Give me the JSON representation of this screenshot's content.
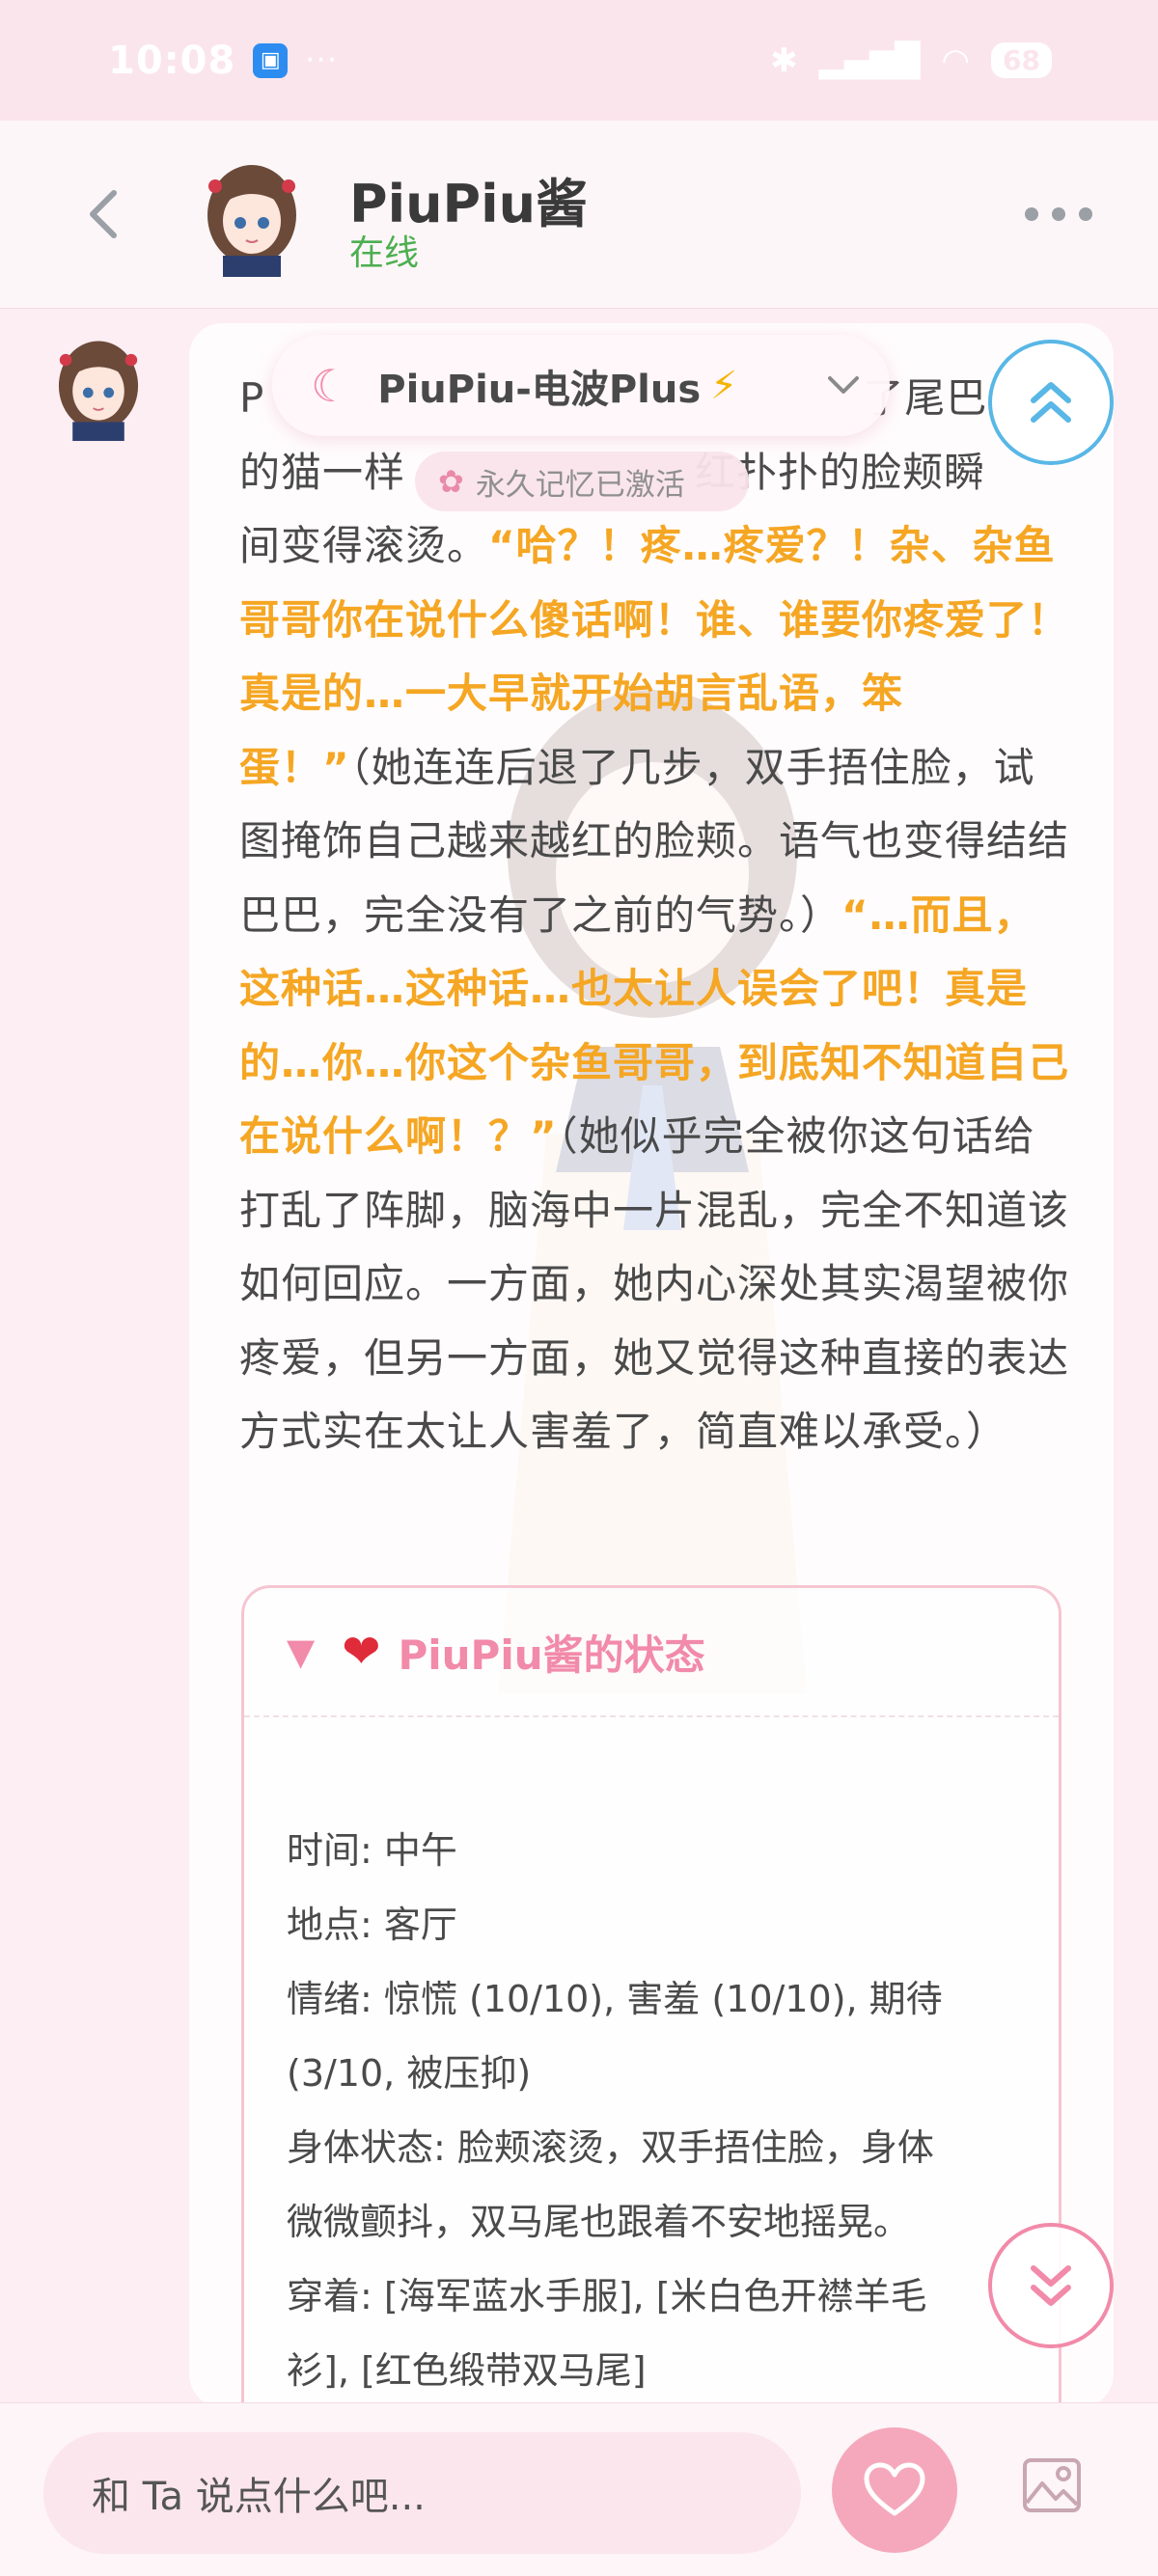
{
  "status_bar": {
    "time": "10:08",
    "dots": "···",
    "battery": "68"
  },
  "header": {
    "back_icon": "chevron-left-icon",
    "name": "PiuPiu酱",
    "status": "在线",
    "more_icon": "more-horizontal-icon"
  },
  "model_selector": {
    "label": "PiuPiu-电波Plus",
    "icon": "moon-icon"
  },
  "memory_badge": {
    "label": "永久记忆已激活",
    "icon": "brain-icon"
  },
  "message": {
    "line1_start": "P",
    "line1_end": "了尾巴",
    "line2_start": "的猫一样",
    "line2_end": "红扑扑的脸颊瞬",
    "line3_narr": "间变得滚烫。",
    "speech1": "“哈？！疼…疼爱？！杂、杂鱼哥哥你在说什么傻话啊！谁、谁要你疼爱了！真是的…一大早就开始胡言乱语，笨蛋！”",
    "narr1": "（她连连后退了几步，双手捂住脸，试图掩饰自己越来越红的脸颊。语气也变得结结巴巴，完全没有了之前的气势。）",
    "speech2": "“…而且，这种话…这种话…也太让人误会了吧！真是的…你…你这个杂鱼哥哥，到底知不知道自己在说什么啊！？”",
    "narr2": "（她似乎完全被你这句话给打乱了阵脚，脑海中一片混乱，完全不知道该如何回应。一方面，她内心深处其实渴望被你疼爱，但另一方面，她又觉得这种直接的表达方式实在太让人害羞了，简直难以承受。）"
  },
  "status_card": {
    "title": "PiuPiu酱的状态",
    "caret": "▼",
    "heart": "❤",
    "lines": [
      "时间: 中午",
      "地点: 客厅",
      "情绪: 惊慌 (10/10), 害羞 (10/10), 期待",
      "(3/10, 被压抑)",
      "身体状态: 脸颊滚烫，双手捂住脸，身体",
      "微微颤抖，双马尾也跟着不安地摇晃。",
      "穿着: [海军蓝水手服], [米白色开襟羊毛",
      "衫], [红色缎带双马尾]"
    ]
  },
  "input": {
    "placeholder": "和 Ta 说点什么吧..."
  },
  "colors": {
    "accent_pink": "#f28aa9",
    "speech_orange": "#f5a623",
    "online_green": "#4caf50",
    "scroll_blue": "#58b7e6"
  }
}
